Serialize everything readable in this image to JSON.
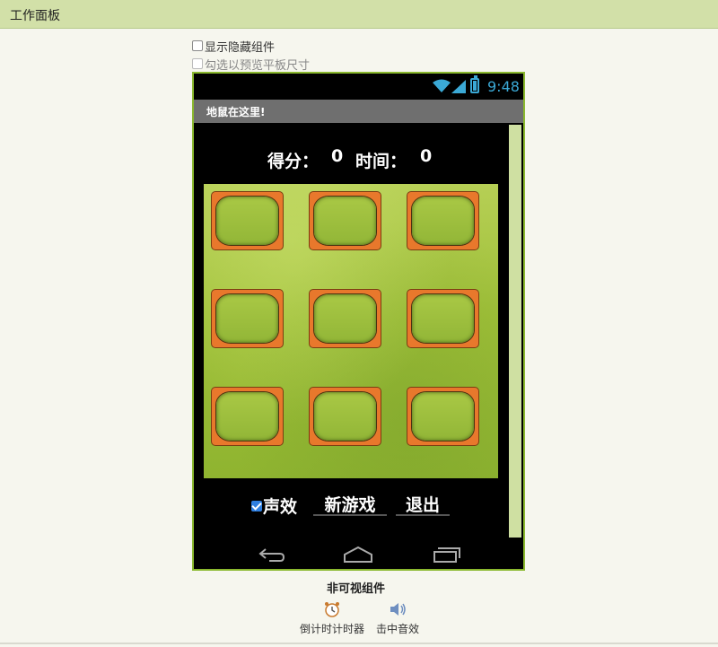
{
  "panel": {
    "title": "工作面板"
  },
  "options": {
    "show_hidden_label": "显示隐藏组件",
    "tablet_preview_label": "勾选以预览平板尺寸"
  },
  "status_bar": {
    "time": "9:48",
    "accent_color": "#3ba9d6"
  },
  "app": {
    "title": "地鼠在这里!",
    "score_label": "得分：",
    "score_value": "0",
    "time_label": "时间：",
    "time_value": "0",
    "sound_label": "声效",
    "sound_checked": true,
    "new_game_label": "新游戏",
    "exit_label": "退出",
    "holes": 9
  },
  "nonvisible": {
    "title": "非可视组件",
    "components": [
      {
        "label": "倒计时计时器",
        "icon": "clock-icon"
      },
      {
        "label": "击中音效",
        "icon": "speaker-icon"
      }
    ]
  },
  "colors": {
    "frame": "#8ab82e",
    "header": "#d2e0a8",
    "hole_rim": "#e8782c"
  }
}
